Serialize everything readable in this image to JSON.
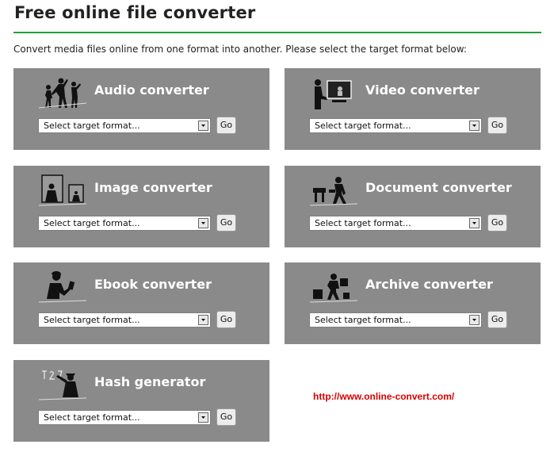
{
  "page": {
    "title": "Free online file converter",
    "intro": "Convert media files online from one format into another. Please select the target format below:",
    "url": "http://www.online-convert.com/"
  },
  "converters": [
    {
      "label": "Audio converter",
      "select_value": "Select target format...",
      "go": "Go",
      "icon": "dancers-silhouette-icon"
    },
    {
      "label": "Video converter",
      "select_value": "Select target format...",
      "go": "Go",
      "icon": "film-viewer-silhouette-icon"
    },
    {
      "label": "Image converter",
      "select_value": "Select target format...",
      "go": "Go",
      "icon": "picture-frames-silhouette-icon"
    },
    {
      "label": "Document converter",
      "select_value": "Select target format...",
      "go": "Go",
      "icon": "office-worker-silhouette-icon"
    },
    {
      "label": "Ebook converter",
      "select_value": "Select target format...",
      "go": "Go",
      "icon": "reader-silhouette-icon"
    },
    {
      "label": "Archive converter",
      "select_value": "Select target format...",
      "go": "Go",
      "icon": "mover-silhouette-icon"
    },
    {
      "label": "Hash generator",
      "select_value": "Select target format...",
      "go": "Go",
      "icon": "formula-silhouette-icon"
    }
  ],
  "colors": {
    "panel": "#8a8a8a",
    "rule": "#1fa23a",
    "url": "#d80000"
  }
}
